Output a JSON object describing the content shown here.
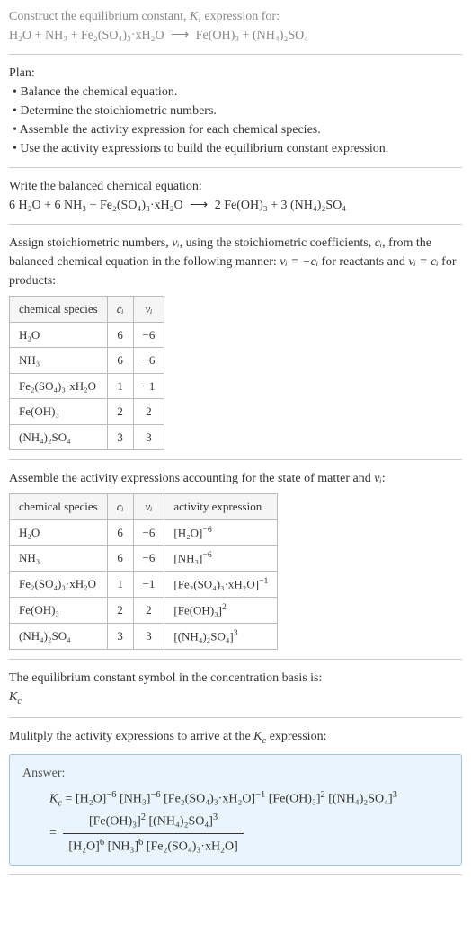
{
  "intro": {
    "line1": "Construct the equilibrium constant, ",
    "Kvar": "K",
    "line1b": ", expression for:",
    "eq_lhs": "H₂O + NH₃ + Fe₂(SO₄)₃·xH₂O",
    "arrow": "⟶",
    "eq_rhs": "Fe(OH)₃ + (NH₄)₂SO₄"
  },
  "plan": {
    "title": "Plan:",
    "b1": "• Balance the chemical equation.",
    "b2": "• Determine the stoichiometric numbers.",
    "b3": "• Assemble the activity expression for each chemical species.",
    "b4": "• Use the activity expressions to build the equilibrium constant expression."
  },
  "balanced": {
    "title": "Write the balanced chemical equation:",
    "lhs": "6 H₂O + 6 NH₃ + Fe₂(SO₄)₃·xH₂O",
    "arrow": "⟶",
    "rhs": "2 Fe(OH)₃ + 3 (NH₄)₂SO₄"
  },
  "stoich": {
    "text_a": "Assign stoichiometric numbers, ",
    "nu": "νᵢ",
    "text_b": ", using the stoichiometric coefficients, ",
    "ci": "cᵢ",
    "text_c": ", from the balanced chemical equation in the following manner: ",
    "rel1": "νᵢ = −cᵢ",
    "text_d": " for reactants and ",
    "rel2": "νᵢ = cᵢ",
    "text_e": " for products:",
    "headers": {
      "species": "chemical species",
      "c": "cᵢ",
      "nu": "νᵢ"
    },
    "rows": [
      {
        "species": "H₂O",
        "c": "6",
        "nu": "−6"
      },
      {
        "species": "NH₃",
        "c": "6",
        "nu": "−6"
      },
      {
        "species": "Fe₂(SO₄)₃·xH₂O",
        "c": "1",
        "nu": "−1"
      },
      {
        "species": "Fe(OH)₃",
        "c": "2",
        "nu": "2"
      },
      {
        "species": "(NH₄)₂SO₄",
        "c": "3",
        "nu": "3"
      }
    ]
  },
  "activity": {
    "text_a": "Assemble the activity expressions accounting for the state of matter and ",
    "nu": "νᵢ",
    "text_b": ":",
    "headers": {
      "species": "chemical species",
      "c": "cᵢ",
      "nu": "νᵢ",
      "act": "activity expression"
    },
    "rows": [
      {
        "species": "H₂O",
        "c": "6",
        "nu": "−6",
        "act_base": "[H₂O]",
        "act_exp": "−6"
      },
      {
        "species": "NH₃",
        "c": "6",
        "nu": "−6",
        "act_base": "[NH₃]",
        "act_exp": "−6"
      },
      {
        "species": "Fe₂(SO₄)₃·xH₂O",
        "c": "1",
        "nu": "−1",
        "act_base": "[Fe₂(SO₄)₃·xH₂O]",
        "act_exp": "−1"
      },
      {
        "species": "Fe(OH)₃",
        "c": "2",
        "nu": "2",
        "act_base": "[Fe(OH)₃]",
        "act_exp": "2"
      },
      {
        "species": "(NH₄)₂SO₄",
        "c": "3",
        "nu": "3",
        "act_base": "[(NH₄)₂SO₄]",
        "act_exp": "3"
      }
    ]
  },
  "symbol": {
    "text": "The equilibrium constant symbol in the concentration basis is:",
    "kc": "K",
    "sub": "c"
  },
  "multiply": {
    "text_a": "Mulitply the activity expressions to arrive at the ",
    "kc": "K",
    "sub": "c",
    "text_b": " expression:"
  },
  "answer": {
    "label": "Answer:",
    "Kc": "K",
    "Kc_sub": "c",
    "eq": " = ",
    "t1": "[H₂O]",
    "e1": "−6",
    "t2": "[NH₃]",
    "e2": "−6",
    "t3": "[Fe₂(SO₄)₃·xH₂O]",
    "e3": "−1",
    "t4": "[Fe(OH)₃]",
    "e4": "2",
    "t5": "[(NH₄)₂SO₄]",
    "e5": "3",
    "eq2": " = ",
    "num_a": "[Fe(OH)₃]",
    "num_ae": "2",
    "num_b": "[(NH₄)₂SO₄]",
    "num_be": "3",
    "den_a": "[H₂O]",
    "den_ae": "6",
    "den_b": "[NH₃]",
    "den_be": "6",
    "den_c": "[Fe₂(SO₄)₃·xH₂O]"
  }
}
